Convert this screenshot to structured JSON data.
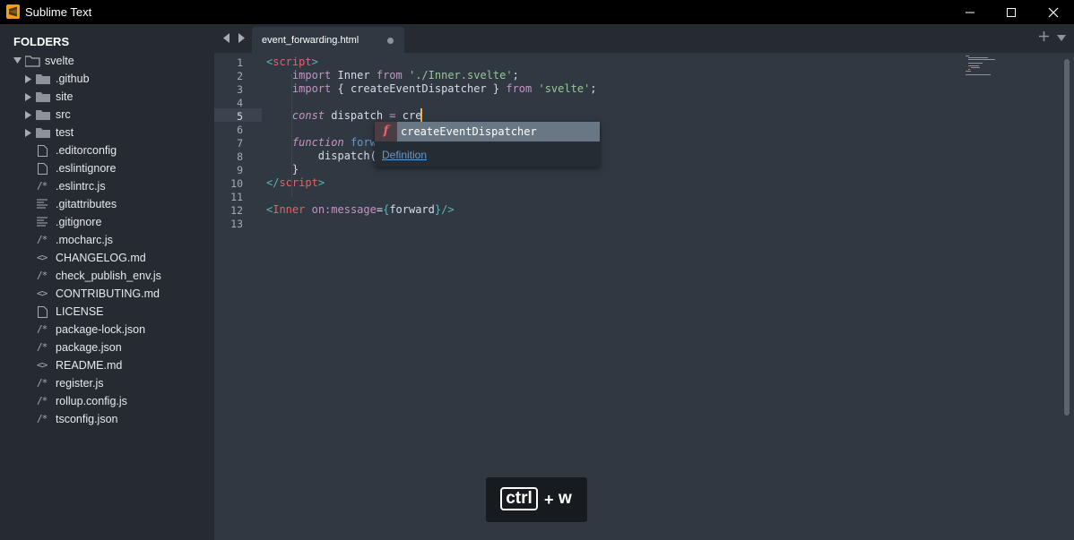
{
  "window": {
    "title": "Sublime Text",
    "accent_color": "#f99b15"
  },
  "sidebar": {
    "header": "FOLDERS",
    "root": {
      "label": "svelte",
      "icon": "folder-open-icon"
    },
    "items": [
      {
        "label": ".github",
        "icon": "folder-icon",
        "type": "folder"
      },
      {
        "label": "site",
        "icon": "folder-icon",
        "type": "folder"
      },
      {
        "label": "src",
        "icon": "folder-icon",
        "type": "folder"
      },
      {
        "label": "test",
        "icon": "folder-icon",
        "type": "folder"
      },
      {
        "label": ".editorconfig",
        "icon": "file-icon",
        "type": "file"
      },
      {
        "label": ".eslintignore",
        "icon": "file-icon",
        "type": "file"
      },
      {
        "label": ".eslintrc.js",
        "icon": "js-file-icon",
        "type": "file",
        "glyph": "/*"
      },
      {
        "label": ".gitattributes",
        "icon": "lines-file-icon",
        "type": "file"
      },
      {
        "label": ".gitignore",
        "icon": "lines-file-icon",
        "type": "file"
      },
      {
        "label": ".mocharc.js",
        "icon": "js-file-icon",
        "type": "file",
        "glyph": "/*"
      },
      {
        "label": "CHANGELOG.md",
        "icon": "markup-file-icon",
        "type": "file",
        "glyph": "<>"
      },
      {
        "label": "check_publish_env.js",
        "icon": "js-file-icon",
        "type": "file",
        "glyph": "/*"
      },
      {
        "label": "CONTRIBUTING.md",
        "icon": "markup-file-icon",
        "type": "file",
        "glyph": "<>"
      },
      {
        "label": "LICENSE",
        "icon": "file-icon",
        "type": "file"
      },
      {
        "label": "package-lock.json",
        "icon": "js-file-icon",
        "type": "file",
        "glyph": "/*"
      },
      {
        "label": "package.json",
        "icon": "js-file-icon",
        "type": "file",
        "glyph": "/*"
      },
      {
        "label": "README.md",
        "icon": "markup-file-icon",
        "type": "file",
        "glyph": "<>"
      },
      {
        "label": "register.js",
        "icon": "js-file-icon",
        "type": "file",
        "glyph": "/*"
      },
      {
        "label": "rollup.config.js",
        "icon": "js-file-icon",
        "type": "file",
        "glyph": "/*"
      },
      {
        "label": "tsconfig.json",
        "icon": "js-file-icon",
        "type": "file",
        "glyph": "/*"
      }
    ]
  },
  "tabs": [
    {
      "label": "event_forwarding.html",
      "modified": true
    }
  ],
  "editor": {
    "active_line": 5,
    "line_numbers": [
      "1",
      "2",
      "3",
      "4",
      "5",
      "6",
      "7",
      "8",
      "9",
      "10",
      "11",
      "12",
      "13"
    ],
    "lines": [
      {
        "tokens": [
          {
            "t": "<",
            "c": "brace"
          },
          {
            "t": "script",
            "c": "tag"
          },
          {
            "t": ">",
            "c": "brace"
          }
        ]
      },
      {
        "tokens": [
          {
            "t": "    "
          },
          {
            "t": "import",
            "c": "kw"
          },
          {
            "t": " Inner "
          },
          {
            "t": "from",
            "c": "kw"
          },
          {
            "t": " "
          },
          {
            "t": "'./Inner.svelte'",
            "c": "str"
          },
          {
            "t": ";"
          }
        ]
      },
      {
        "tokens": [
          {
            "t": "    "
          },
          {
            "t": "import",
            "c": "kw"
          },
          {
            "t": " { createEventDispatcher } "
          },
          {
            "t": "from",
            "c": "kw"
          },
          {
            "t": " "
          },
          {
            "t": "'svelte'",
            "c": "str"
          },
          {
            "t": ";"
          }
        ]
      },
      {
        "tokens": []
      },
      {
        "tokens": [
          {
            "t": "    "
          },
          {
            "t": "const",
            "c": "kwi"
          },
          {
            "t": " dispatch "
          },
          {
            "t": "=",
            "c": "kw"
          },
          {
            "t": " cre"
          }
        ]
      },
      {
        "tokens": []
      },
      {
        "tokens": [
          {
            "t": "    "
          },
          {
            "t": "function",
            "c": "kwi"
          },
          {
            "t": " "
          },
          {
            "t": "forw",
            "c": "fn"
          }
        ]
      },
      {
        "tokens": [
          {
            "t": "        "
          },
          {
            "t": "dispatch("
          }
        ]
      },
      {
        "tokens": [
          {
            "t": "    }"
          }
        ]
      },
      {
        "tokens": [
          {
            "t": "</",
            "c": "brace"
          },
          {
            "t": "script",
            "c": "tag"
          },
          {
            "t": ">",
            "c": "brace"
          }
        ]
      },
      {
        "tokens": []
      },
      {
        "tokens": [
          {
            "t": "<",
            "c": "brace"
          },
          {
            "t": "Inner",
            "c": "tag"
          },
          {
            "t": " "
          },
          {
            "t": "on:message",
            "c": "attr"
          },
          {
            "t": "="
          },
          {
            "t": "{",
            "c": "brace"
          },
          {
            "t": "forward"
          },
          {
            "t": "}",
            "c": "brace"
          },
          {
            "t": "/>",
            "c": "brace"
          }
        ]
      },
      {
        "tokens": []
      }
    ]
  },
  "autocomplete": {
    "kind_symbol": "f",
    "suggestion": "createEventDispatcher",
    "link_label": "Definition"
  },
  "keystroke_overlay": {
    "key1": "ctrl",
    "plus": "+",
    "key2": "w"
  }
}
